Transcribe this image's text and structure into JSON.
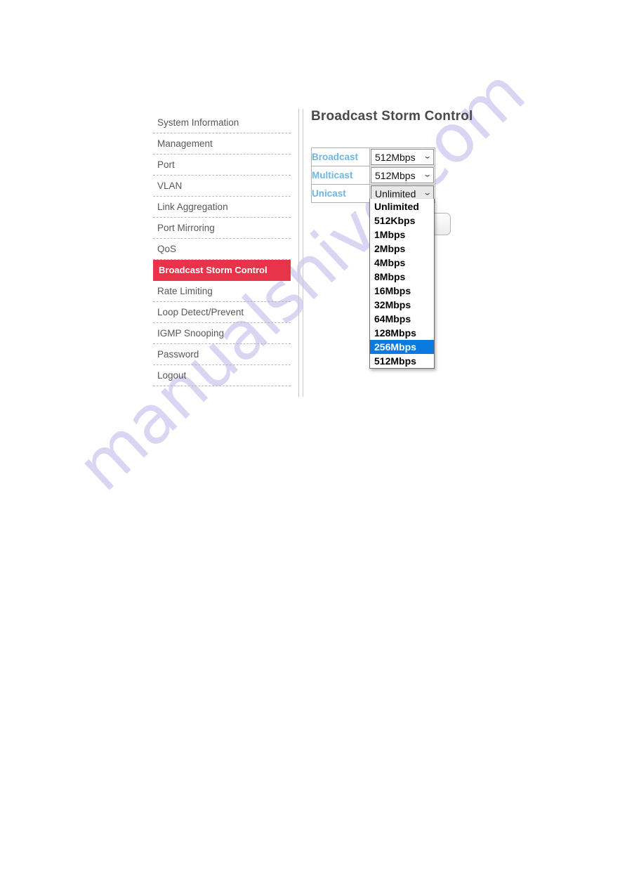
{
  "watermark": {
    "text": "manualshive.com"
  },
  "sidebar": {
    "items": [
      {
        "label": "System Information",
        "active": false
      },
      {
        "label": "Management",
        "active": false
      },
      {
        "label": "Port",
        "active": false
      },
      {
        "label": "VLAN",
        "active": false
      },
      {
        "label": "Link Aggregation",
        "active": false
      },
      {
        "label": "Port Mirroring",
        "active": false
      },
      {
        "label": "QoS",
        "active": false
      },
      {
        "label": "Broadcast Storm Control",
        "active": true
      },
      {
        "label": "Rate Limiting",
        "active": false
      },
      {
        "label": "Loop Detect/Prevent",
        "active": false
      },
      {
        "label": "IGMP Snooping",
        "active": false
      },
      {
        "label": "Password",
        "active": false
      },
      {
        "label": "Logout",
        "active": false
      }
    ]
  },
  "content": {
    "title": "Broadcast Storm Control",
    "rows": [
      {
        "label": "Broadcast",
        "value": "512Mbps",
        "open": false
      },
      {
        "label": "Multicast",
        "value": "512Mbps",
        "open": false
      },
      {
        "label": "Unicast",
        "value": "Unlimited",
        "open": true
      }
    ],
    "apply_button_label": ""
  },
  "dropdown": {
    "open_for_row": "Unicast",
    "selected": "256Mbps",
    "options": [
      "Unlimited",
      "512Kbps",
      "1Mbps",
      "2Mbps",
      "4Mbps",
      "8Mbps",
      "16Mbps",
      "32Mbps",
      "64Mbps",
      "128Mbps",
      "256Mbps",
      "512Mbps"
    ]
  },
  "icons": {
    "chevron_down": "⌄"
  },
  "colors": {
    "active_nav_background": "#e8344a",
    "label_text": "#6fb6e0",
    "selected_option_background": "#0a7ae0",
    "watermark": "#d8d6f2"
  }
}
